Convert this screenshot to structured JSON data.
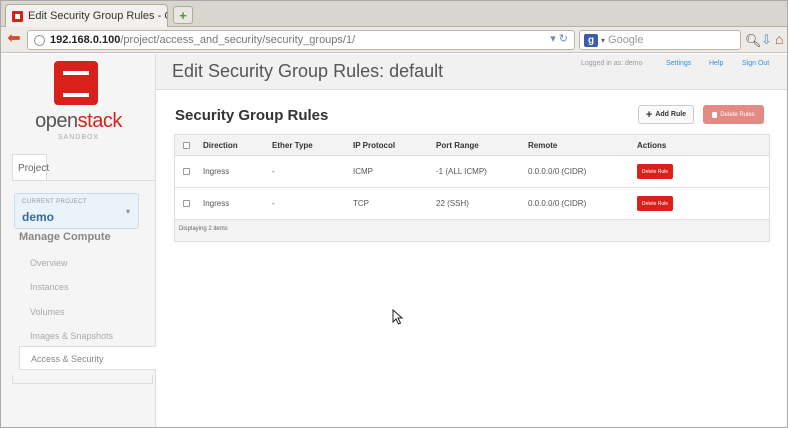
{
  "browser": {
    "tab_title": "Edit Security Group Rules - Op...",
    "url_host": "192.168.0.100",
    "url_path": "/project/access_and_security/security_groups/1/",
    "search_placeholder": "Google"
  },
  "sidebar": {
    "logo_open": "open",
    "logo_stack": "stack",
    "logo_sub": "SANDBOX",
    "tab_label": "Project",
    "current_project_label": "CURRENT PROJECT",
    "current_project_value": "demo",
    "section_title": "Manage Compute",
    "items": [
      {
        "label": "Overview"
      },
      {
        "label": "Instances"
      },
      {
        "label": "Volumes"
      },
      {
        "label": "Images & Snapshots"
      },
      {
        "label": "Access & Security"
      }
    ]
  },
  "header": {
    "title": "Edit Security Group Rules: default",
    "logged_in": "Logged in as: demo",
    "settings": "Settings",
    "help": "Help",
    "sign_out": "Sign Out"
  },
  "content": {
    "section_title": "Security Group Rules",
    "add_rule": "Add Rule",
    "delete_rules": "Delete Rules",
    "columns": [
      "Direction",
      "Ether Type",
      "IP Protocol",
      "Port Range",
      "Remote",
      "Actions"
    ],
    "rows": [
      {
        "direction": "Ingress",
        "ether_type": "-",
        "ip_protocol": "ICMP",
        "port_range": "-1 (ALL ICMP)",
        "remote": "0.0.0.0/0 (CIDR)",
        "action": "Delete Rule"
      },
      {
        "direction": "Ingress",
        "ether_type": "-",
        "ip_protocol": "TCP",
        "port_range": "22 (SSH)",
        "remote": "0.0.0.0/0 (CIDR)",
        "action": "Delete Rule"
      }
    ],
    "footer": "Displaying 2 items"
  },
  "colors": {
    "brand_red": "#d8211b",
    "link_blue": "#3a8fd1"
  }
}
